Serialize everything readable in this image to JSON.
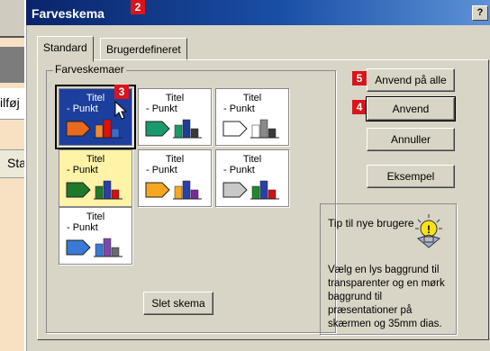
{
  "background": {
    "row1_text": "ilføj",
    "row2_text": "Sta"
  },
  "window": {
    "title": "Farveskema",
    "help_label": "?"
  },
  "tabs": [
    {
      "label": "Standard",
      "active": true
    },
    {
      "label": "Brugerdefineret",
      "active": false
    }
  ],
  "group": {
    "label": "Farveskemaer"
  },
  "schemes": [
    {
      "title": "Titel",
      "point": "- Punkt",
      "bg": "#1c3f9e",
      "text": "#ffffff",
      "shape": "#e86a1e",
      "bars": [
        "#f28b2a",
        "#e01010",
        "#2f6fd6"
      ]
    },
    {
      "title": "Titel",
      "point": "- Punkt",
      "bg": "#ffffff",
      "text": "#000000",
      "shape": "#1a9a6a",
      "bars": [
        "#1a9a6a",
        "#1b3f98",
        "#3a3a3a"
      ]
    },
    {
      "title": "Titel",
      "point": "- Punkt",
      "bg": "#ffffff",
      "text": "#000000",
      "shape": "#ffffff",
      "bars": [
        "#ffffff",
        "#8a8a8a",
        "#3a3a3a"
      ]
    },
    {
      "title": "Titel",
      "point": "- Punkt",
      "bg": "#fff3a8",
      "text": "#000000",
      "shape": "#1e7a2a",
      "bars": [
        "#1e7a2a",
        "#2a3fa8",
        "#d01010"
      ]
    },
    {
      "title": "Titel",
      "point": "- Punkt",
      "bg": "#ffffff",
      "text": "#000000",
      "shape": "#f5a623",
      "bars": [
        "#f5a623",
        "#2a3fa8",
        "#7a2a9a"
      ]
    },
    {
      "title": "Titel",
      "point": "- Punkt",
      "bg": "#ffffff",
      "text": "#000000",
      "shape": "#c8c8c8",
      "bars": [
        "#1e8a2a",
        "#2a3fa8",
        "#d01010"
      ]
    },
    {
      "title": "Titel",
      "point": "- Punkt",
      "bg": "#ffffff",
      "text": "#000000",
      "shape": "#3a7ad6",
      "bars": [
        "#3a7ad6",
        "#7a4aa8",
        "#6a6a6a"
      ]
    }
  ],
  "buttons": {
    "apply_all": "Anvend på alle",
    "apply": "Anvend",
    "cancel": "Annuller",
    "preview": "Eksempel",
    "delete_scheme": "Slet skema"
  },
  "badges": {
    "title": "2",
    "scheme": "3",
    "apply": "4",
    "apply_all": "5"
  },
  "tip": {
    "heading": "Tip til nye brugere",
    "body": "Vælg en lys baggrund til transparenter og en mørk baggrund til præsentationer på skærmen og 35mm dias."
  }
}
